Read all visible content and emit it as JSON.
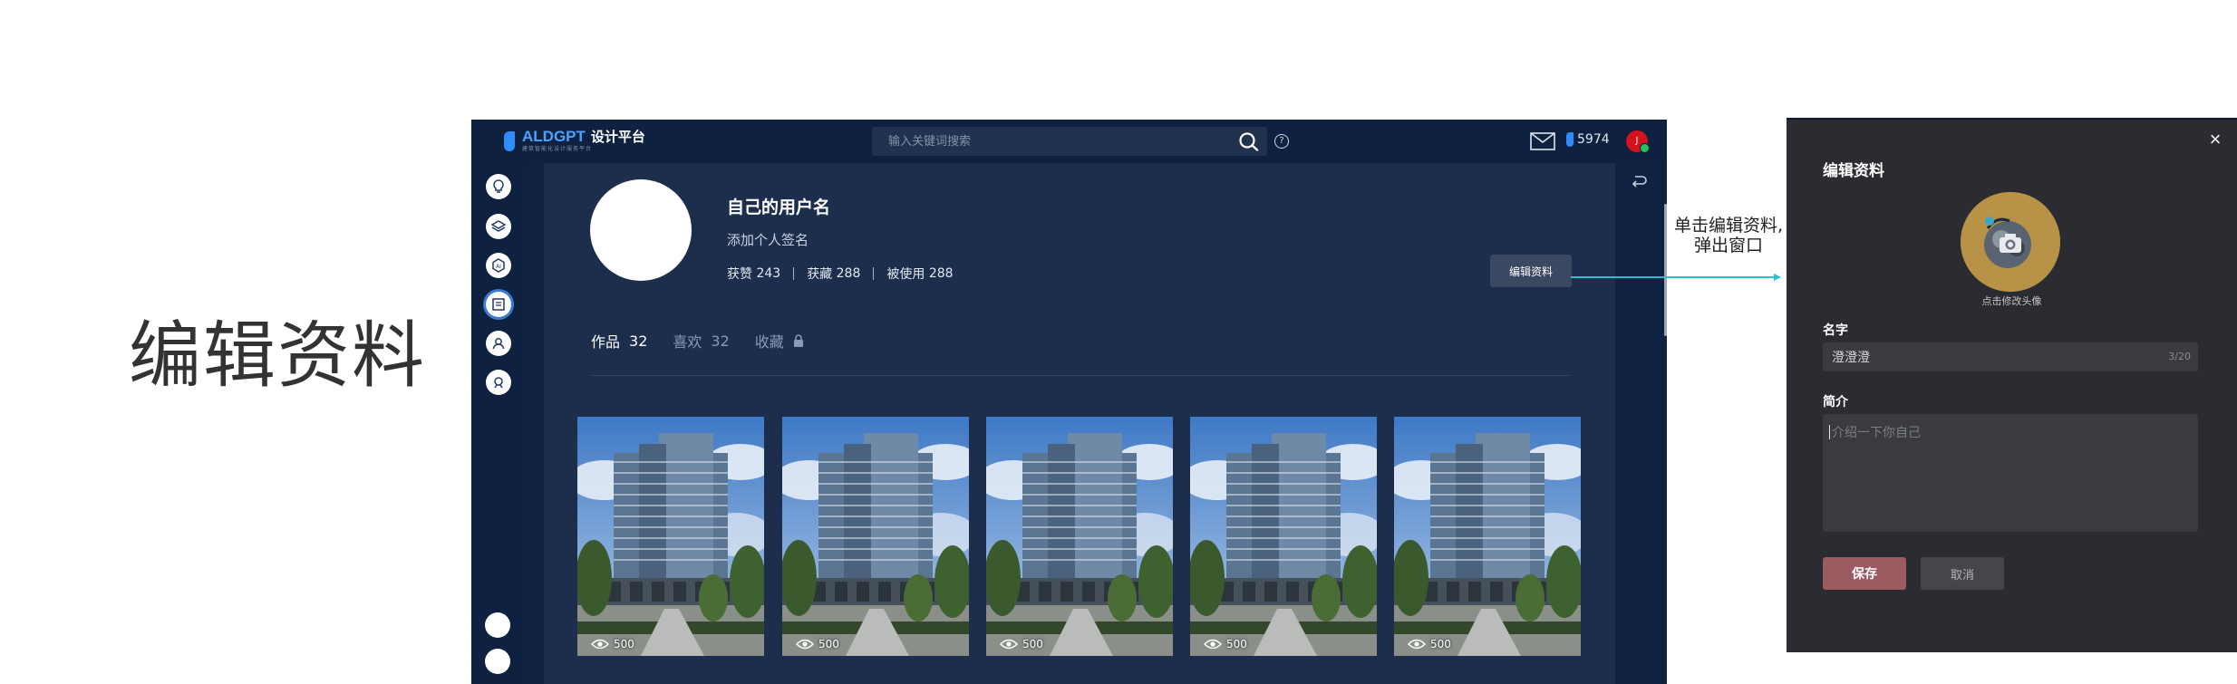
{
  "page": {
    "heading": "编辑资料"
  },
  "topbar": {
    "logo_main": "ALDGPT",
    "logo_suffix": "设计平台",
    "logo_sub": "建筑智能化设计服务平台",
    "search_placeholder": "输入关键词搜索",
    "coins": "5974",
    "avatar_initial": "J"
  },
  "sidebar": {
    "icons": [
      "lightbulb-icon",
      "layers-icon",
      "ai-icon",
      "gallery-icon",
      "user-icon",
      "settings-icon"
    ],
    "active_index": 3
  },
  "profile": {
    "username": "自己的用户名",
    "bio": "添加个人签名",
    "stats": [
      {
        "label": "获赞",
        "value": "243"
      },
      {
        "label": "获藏",
        "value": "288"
      },
      {
        "label": "被使用",
        "value": "288"
      }
    ],
    "edit_button": "编辑资料"
  },
  "tabs": [
    {
      "label": "作品",
      "count": "32",
      "active": true
    },
    {
      "label": "喜欢",
      "count": "32",
      "active": false
    },
    {
      "label": "收藏",
      "count": "",
      "active": false,
      "locked": true
    }
  ],
  "cards": [
    {
      "views": "500"
    },
    {
      "views": "500"
    },
    {
      "views": "500"
    },
    {
      "views": "500"
    },
    {
      "views": "500"
    }
  ],
  "annotation": {
    "line1": "单击编辑资料,",
    "line2": "弹出窗口"
  },
  "dialog": {
    "title": "编辑资料",
    "avatar_caption": "点击修改头像",
    "name_label": "名字",
    "name_value": "澄澄澄",
    "name_count": "3/20",
    "bio_label": "简介",
    "bio_placeholder": "介绍一下你自己",
    "save": "保存",
    "cancel": "取消"
  },
  "colors": {
    "accent_teal": "#27c2c7",
    "save_button": "#9c5a61",
    "app_bg": "#0f2242"
  }
}
